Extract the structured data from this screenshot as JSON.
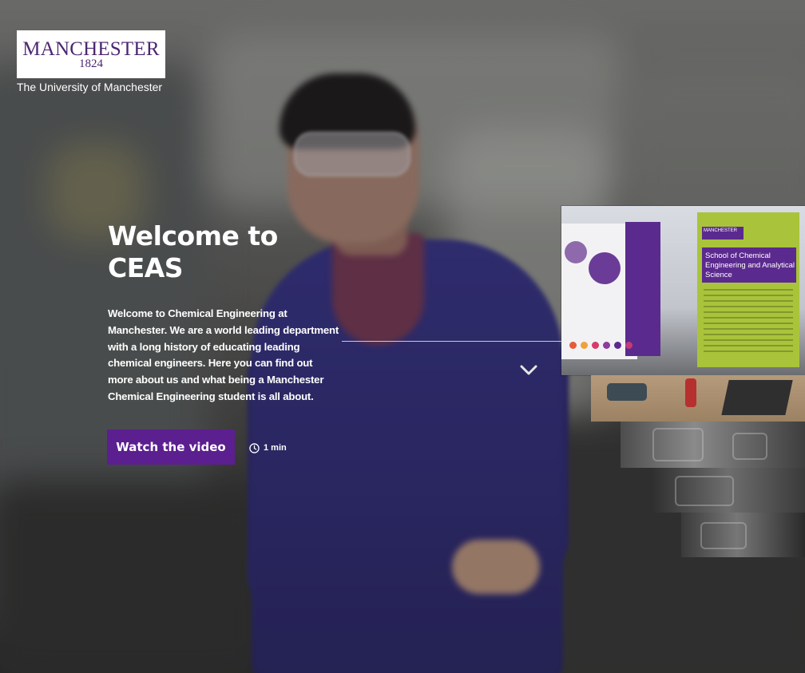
{
  "brand": {
    "logo_name": "MANCHESTER",
    "logo_year": "1824",
    "university": "The University of Manchester"
  },
  "hero": {
    "title_line1": "Welcome to",
    "title_line2": "CEAS",
    "description": "Welcome to Chemical Engineering at Manchester. We are a world leading department with a long history of educating leading chemical engineers. Here you can find out more about us and what being a Manchester Chemical Engineering student is all about.",
    "cta_label": "Watch the video",
    "duration": "1 min",
    "duration_icon": "clock-icon",
    "scroll_icon": "chevron-down-icon"
  },
  "gallery": {
    "banner_title": "School of Chemical Engineering and Analytical Science",
    "banner_logo": "MANCHESTER",
    "dot_colors": [
      "#e55c3b",
      "#f0a23a",
      "#d63b6b",
      "#8e3c9c",
      "#5b2a8e",
      "#c23a7a"
    ]
  },
  "colors": {
    "accent": "#5b1f8f",
    "brand_purple": "#4b2770",
    "banner_green": "#a9c43a"
  }
}
